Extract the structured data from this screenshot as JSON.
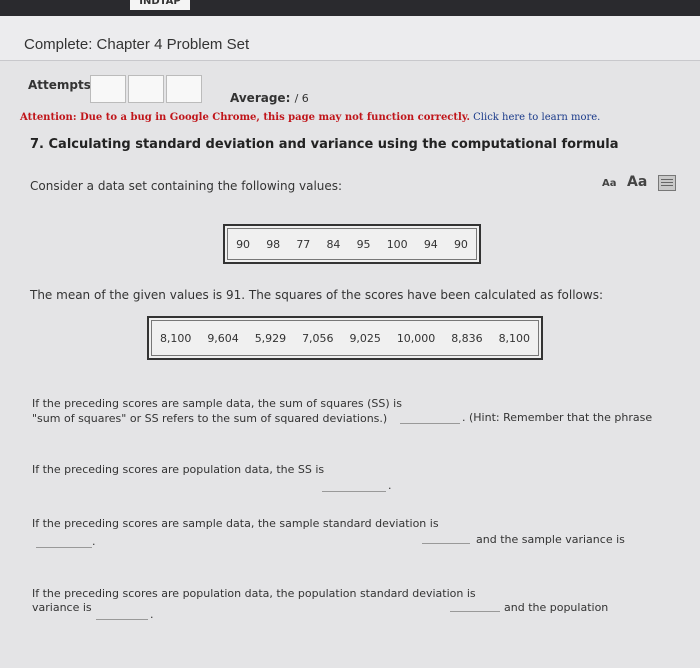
{
  "topbar": {
    "logo_fragment": "INDTAP"
  },
  "header": {
    "title": "Complete: Chapter 4 Problem Set"
  },
  "attempts": {
    "label": "Attempts:",
    "average_label": "Average:",
    "average_value": "/ 6"
  },
  "attention": {
    "prefix": "Attention: Due to a bug in Google Chrome, this page may not function correctly.",
    "link": "Click here to learn more."
  },
  "question": {
    "title": "7. Calculating standard deviation and variance using the computational formula",
    "intro": "Consider a data set containing the following values:",
    "values": [
      "90",
      "98",
      "77",
      "84",
      "95",
      "100",
      "94",
      "90"
    ],
    "mean_text": "The mean of the given values is 91. The squares of the scores have been calculated as follows:",
    "squares": [
      "8,100",
      "9,604",
      "5,929",
      "7,056",
      "9,025",
      "10,000",
      "8,836",
      "8,100"
    ],
    "q1_part1": "If the preceding scores are sample data, the sum of squares (SS) is",
    "q1_part2": ". (Hint: Remember that the phrase",
    "q1_part3": "\"sum of squares\" or SS refers to the sum of squared deviations.)",
    "q2": "If the preceding scores are population data, the SS is",
    "q2_end": ".",
    "q3_part1": "If the preceding scores are sample data, the sample standard deviation is",
    "q3_part2": "and the sample variance is",
    "q3_end": ".",
    "q4_part1": "If the preceding scores are population data, the population standard deviation is",
    "q4_part2": "and the population",
    "q4_part3": "variance is",
    "q4_end": "."
  },
  "text_size": {
    "small": "Aa",
    "large": "Aa"
  },
  "icons": {
    "book": "book-icon"
  }
}
